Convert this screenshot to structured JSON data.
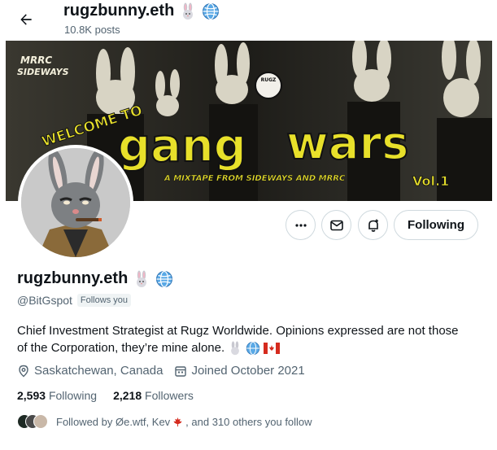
{
  "header": {
    "name": "rugzbunny.eth",
    "posts": "10.8K posts"
  },
  "banner": {
    "corner_text_1": "MRRC",
    "corner_text_2": "SIDEWAYS",
    "welcome": "WELCOME TO",
    "title_1": "gang",
    "title_2": "wars",
    "subtitle": "A MIXTAPE FROM SIDEWAYS AND MRRC",
    "vol": "Vol.1",
    "badge": "RUGZ"
  },
  "actions": {
    "more_icon": "more-icon",
    "message_icon": "message-icon",
    "notify_icon": "notify-icon",
    "follow_label": "Following"
  },
  "profile": {
    "name": "rugzbunny.eth",
    "handle": "@BitGspot",
    "follows_you": "Follows you",
    "bio_line_1": "Chief Investment Strategist at Rugz Worldwide.  Opinions expressed are not those",
    "bio_line_2": "of the Corporation, they’re mine alone.",
    "location": "Saskatchewan, Canada",
    "joined": "Joined October 2021",
    "following_count": "2,593",
    "following_label": "Following",
    "followers_count": "2,218",
    "followers_label": "Followers",
    "followed_by_prefix": "Followed by Øe.wtf, Kev",
    "followed_by_suffix": ", and 310 others you follow"
  },
  "colors": {
    "accent": "#1d9bf0",
    "text": "#0f1419",
    "muted": "#536471",
    "banner_yellow": "#e8e02a"
  }
}
